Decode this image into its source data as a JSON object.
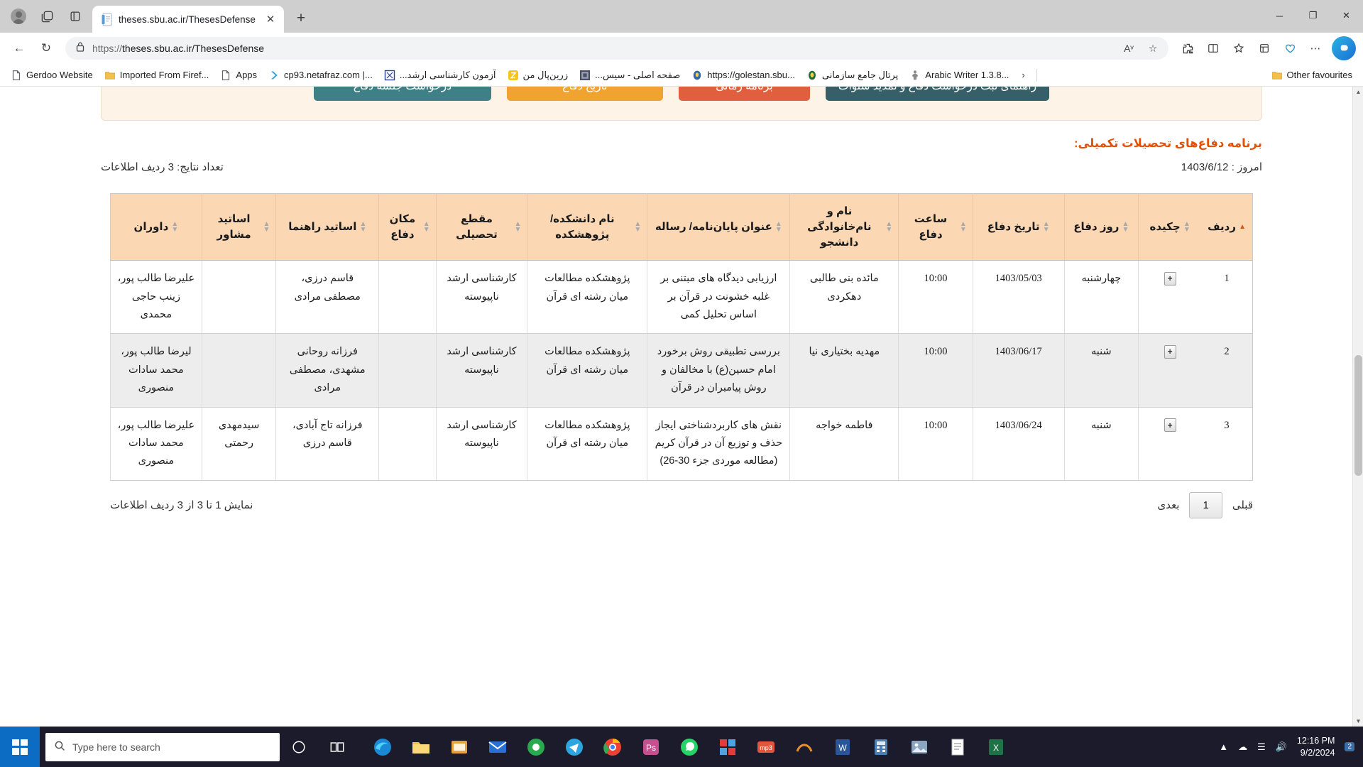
{
  "browser": {
    "tab": {
      "title": "theses.sbu.ac.ir/ThesesDefense",
      "favicon_name": "document-favicon",
      "close_label": "✕"
    },
    "newtab_label": "+",
    "window_controls": {
      "minimize": "─",
      "maximize": "❐",
      "close": "✕"
    },
    "nav": {
      "back": "←",
      "reload": "↻"
    },
    "omnibox": {
      "scheme": "https://",
      "host_path": "theses.sbu.ac.ir/ThesesDefense",
      "lock_icon": "lock-icon",
      "read_aloud": "Aᵛ",
      "favourite_star": "☆"
    },
    "toolbar": {
      "extensions": "⧉",
      "split_screen": "▥",
      "favourites": "☆",
      "collections": "⊞",
      "browser_essentials": "♡",
      "settings_more": "⋯",
      "copilot": "⬟"
    },
    "bookmarks": [
      {
        "label": "Gerdoo Website",
        "icon": "page-icon",
        "rtl": false
      },
      {
        "label": "Imported From Firef...",
        "icon": "folder-icon",
        "rtl": false
      },
      {
        "label": "Apps",
        "icon": "page-icon",
        "rtl": false
      },
      {
        "label": "cp93.netafraz.com |...",
        "icon": "netafraz-icon",
        "rtl": false
      },
      {
        "label": "آزمون کارشناسی ارشد...",
        "icon": "blue-square-icon",
        "rtl": true
      },
      {
        "label": "زرین‌پال من",
        "icon": "zarinpal-icon",
        "rtl": true
      },
      {
        "label": "صفحه اصلی - سیس...",
        "icon": "dark-square-icon",
        "rtl": true
      },
      {
        "label": "https://golestan.sbu...",
        "icon": "golestan-icon",
        "rtl": false
      },
      {
        "label": "پرتال جامع سازمانی",
        "icon": "seal-icon",
        "rtl": true
      },
      {
        "label": "Arabic Writer 1.3.8...",
        "icon": "person-icon",
        "rtl": false
      }
    ],
    "bookmarks_overflow": "›",
    "other_favourites": {
      "label": "Other favourites",
      "icon": "folder-icon"
    }
  },
  "page": {
    "buttons": [
      {
        "label": "راهنمای ثبت درخواست دفاع و تمدید سنوات",
        "color": "dark"
      },
      {
        "label": "برنامه زمانی",
        "color": "red"
      },
      {
        "label": "تاریخ دفاع",
        "color": "orange"
      },
      {
        "label": "درخواست جلسه دفاع",
        "color": "teal"
      }
    ],
    "title": "برنامه دفاع‌های تحصیلات تکمیلی:",
    "today": "امروز : 1403/6/12",
    "result_count": "تعداد نتایج: 3 ردیف اطلاعات",
    "accent_color": "#e2510a",
    "header_bg": "#fbd7b3"
  },
  "table": {
    "columns": [
      {
        "key": "row",
        "label": "ردیف",
        "sorted": true
      },
      {
        "key": "abstract",
        "label": "چکیده",
        "sorted": false
      },
      {
        "key": "day",
        "label": "روز دفاع",
        "sorted": false
      },
      {
        "key": "date",
        "label": "تاریخ دفاع",
        "sorted": false
      },
      {
        "key": "time",
        "label": "ساعت دفاع",
        "sorted": false
      },
      {
        "key": "student",
        "label": "نام و نام‌خانوادگی دانشجو",
        "sorted": false
      },
      {
        "key": "thesis",
        "label": "عنوان پایان‌نامه/ رساله",
        "sorted": false
      },
      {
        "key": "faculty",
        "label": "نام دانشکده/ پژوهشکده",
        "sorted": false
      },
      {
        "key": "degree",
        "label": "مقطع تحصیلی",
        "sorted": false
      },
      {
        "key": "place",
        "label": "مکان دفاع",
        "sorted": false
      },
      {
        "key": "supervisor",
        "label": "اساتید راهنما",
        "sorted": false
      },
      {
        "key": "advisor",
        "label": "اساتید مشاور",
        "sorted": false
      },
      {
        "key": "referees",
        "label": "داوران",
        "sorted": false
      }
    ],
    "expand_glyph": "+",
    "rows": [
      {
        "row": "1",
        "day": "چهارشنبه",
        "date": "1403/05/03",
        "time": "10:00",
        "student": "مائده بنی طالبی دهکردی",
        "thesis": "ارزیابی دیدگاه های مبتنی بر غلبه خشونت در قرآن بر اساس تحلیل کمی",
        "faculty": "پژوهشکده مطالعات میان رشته ای قرآن",
        "degree": "کارشناسی ارشد ناپیوسته",
        "place": "",
        "supervisor": "قاسم درزی، مصطفی مرادی",
        "advisor": "",
        "referees": "علیرضا طالب پور، زینب حاجی محمدی"
      },
      {
        "row": "2",
        "day": "شنبه",
        "date": "1403/06/17",
        "time": "10:00",
        "student": "مهدیه بختیاری نیا",
        "thesis": "بررسی تطبیقی روش برخورد امام حسین(ع) با مخالفان و روش پیامبران در قرآن",
        "faculty": "پژوهشکده مطالعات میان رشته ای قرآن",
        "degree": "کارشناسی ارشد ناپیوسته",
        "place": "",
        "supervisor": "فرزانه روحانی مشهدی، مصطفی مرادی",
        "advisor": "",
        "referees": "لیرضا طالب پور، محمد سادات منصوری"
      },
      {
        "row": "3",
        "day": "شنبه",
        "date": "1403/06/24",
        "time": "10:00",
        "student": "فاطمه خواجه",
        "thesis": "نقش های کاربردشناختی ایجاز حذف و توزیع آن در قرآن کریم (مطالعه موردی جزء 30-26)",
        "faculty": "پژوهشکده مطالعات میان رشته ای قرآن",
        "degree": "کارشناسی ارشد ناپیوسته",
        "place": "",
        "supervisor": "فرزانه تاج آبادی، قاسم درزی",
        "advisor": "سیدمهدی رحمتی",
        "referees": "علیرضا طالب پور، محمد سادات منصوری"
      }
    ]
  },
  "pager": {
    "previous": "قبلی",
    "current_page": "1",
    "next": "بعدی",
    "info": "نمایش 1 تا 3 از 3 ردیف اطلاعات"
  },
  "taskbar": {
    "search_placeholder": "Type here to search",
    "time": "12:16 PM",
    "date": "9/2/2024",
    "notification_count": "2",
    "apps": [
      "cortana-icon",
      "task-view-icon",
      "edge-icon",
      "file-explorer-icon",
      "store-icon",
      "mail-icon",
      "chrome-canary-icon",
      "telegram-icon",
      "chrome-icon",
      "photoshop-icon",
      "whatsapp-icon",
      "grid-icon",
      "mp3-icon",
      "curve-icon",
      "word-icon",
      "calculator-icon",
      "gallery-icon",
      "notepad-icon",
      "excel-icon"
    ]
  }
}
